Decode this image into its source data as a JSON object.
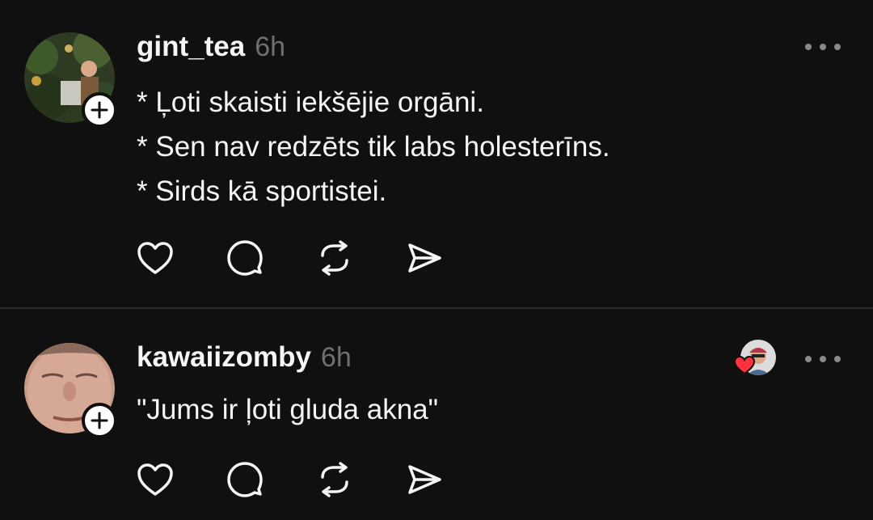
{
  "posts": [
    {
      "username": "gint_tea",
      "time": "6h",
      "lines": [
        "* Ļoti skaisti iekšējie orgāni.",
        "* Sen nav redzēts tik labs holesterīns.",
        "* Sirds kā sportistei."
      ],
      "actions": [
        "heart-icon",
        "comment-icon",
        "repost-icon",
        "share-icon"
      ]
    },
    {
      "username": "kawaiizomby",
      "time": "6h",
      "lines": [
        "\"Jums ir ļoti gluda akna\""
      ],
      "liked_by_icon": "red-heart-icon",
      "actions": [
        "heart-icon",
        "comment-icon",
        "repost-icon",
        "share-icon"
      ]
    }
  ],
  "colors": {
    "background": "#101010",
    "text": "#f3f5f7",
    "muted": "#6f6f6f",
    "heart": "#ff3040"
  }
}
